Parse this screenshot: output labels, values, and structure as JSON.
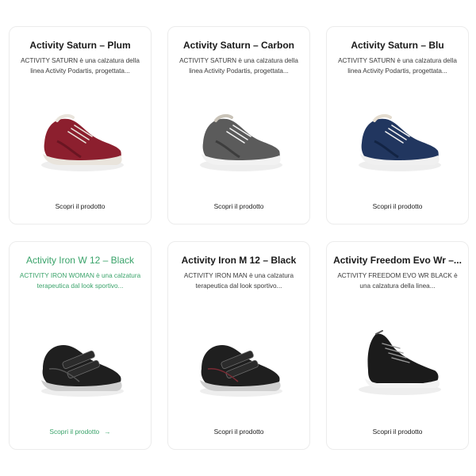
{
  "products": [
    {
      "title": "Activity Saturn – Plum",
      "description": "ACTIVITY SATURN è una calzatura della linea Activity Podartis, progettata...",
      "cta": "Scopri il prodotto",
      "color": "#8c1f2e",
      "sole": "#e9e4dc",
      "style": "lace"
    },
    {
      "title": "Activity Saturn – Carbon",
      "description": "ACTIVITY SATURN è una calzatura della linea Activity Podartis, progettata...",
      "cta": "Scopri il prodotto",
      "color": "#5b5b5b",
      "sole": "#f2f2f2",
      "style": "lace"
    },
    {
      "title": "Activity Saturn – Blu",
      "description": "ACTIVITY SATURN è una calzatura della linea Activity Podartis, progettata...",
      "cta": "Scopri il prodotto",
      "color": "#21365f",
      "sole": "#f0f0f0",
      "style": "lace"
    },
    {
      "title": "Activity Iron W 12 – Black",
      "description": "ACTIVITY IRON WOMAN è una calzatura terapeutica dal look sportivo...",
      "cta": "Scopri il prodotto",
      "cta_icon": "arrow-right-icon",
      "color": "#1f1f1f",
      "sole": "#cfcfcf",
      "style": "strap",
      "highlighted": true
    },
    {
      "title": "Activity Iron M 12 – Black",
      "description": "ACTIVITY IRON MAN è una calzatura terapeutica dal look sportivo...",
      "cta": "Scopri il prodotto",
      "color": "#1f1f1f",
      "sole": "#cfcfcf",
      "style": "strap"
    },
    {
      "title": "Activity Freedom Evo Wr –...",
      "description": "ACTIVITY FREEDOM EVO WR BLACK è una calzatura della linea...",
      "cta": "Scopri il prodotto",
      "color": "#1b1b1b",
      "sole": "#f3f3f3",
      "style": "boot"
    }
  ],
  "colors": {
    "accent": "#3aa36a"
  }
}
